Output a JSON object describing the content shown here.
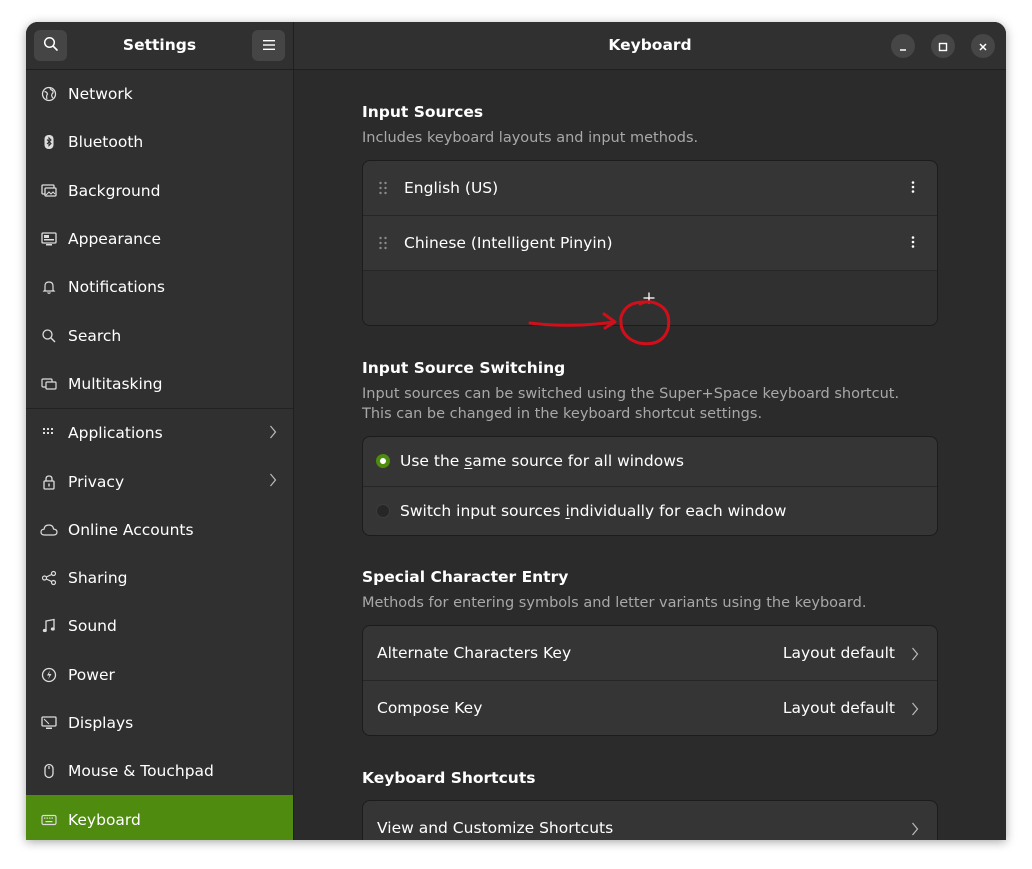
{
  "sidebar": {
    "title": "Settings",
    "search_icon": "search-icon",
    "menu_icon": "hamburger-menu-icon",
    "items": [
      {
        "label": "Network",
        "icon": "globe-icon"
      },
      {
        "label": "Bluetooth",
        "icon": "bluetooth-icon"
      },
      {
        "label": "Background",
        "icon": "background-icon"
      },
      {
        "label": "Appearance",
        "icon": "appearance-icon"
      },
      {
        "label": "Notifications",
        "icon": "bell-icon"
      },
      {
        "label": "Search",
        "icon": "search-icon"
      },
      {
        "label": "Multitasking",
        "icon": "multitasking-icon"
      },
      {
        "label": "Applications",
        "icon": "grid-icon"
      },
      {
        "label": "Privacy",
        "icon": "lock-icon"
      },
      {
        "label": "Online Accounts",
        "icon": "cloud-icon"
      },
      {
        "label": "Sharing",
        "icon": "share-icon"
      },
      {
        "label": "Sound",
        "icon": "music-note-icon"
      },
      {
        "label": "Power",
        "icon": "power-icon"
      },
      {
        "label": "Displays",
        "icon": "display-icon"
      },
      {
        "label": "Mouse & Touchpad",
        "icon": "mouse-icon"
      },
      {
        "label": "Keyboard",
        "icon": "keyboard-icon"
      }
    ],
    "active": "Keyboard"
  },
  "header": {
    "title": "Keyboard"
  },
  "input_sources": {
    "title": "Input Sources",
    "description": "Includes keyboard layouts and input methods.",
    "sources": [
      {
        "label": "English (US)"
      },
      {
        "label": "Chinese (Intelligent Pinyin)"
      }
    ],
    "annotation": "red hand-drawn arrow and circle around add button"
  },
  "switching": {
    "title": "Input Source Switching",
    "description_1": "Input sources can be switched using the Super+Space keyboard shortcut.",
    "description_2": "This can be changed in the keyboard shortcut settings.",
    "option_same_pre": "Use the ",
    "option_same_u": "s",
    "option_same_post": "ame source for all windows",
    "option_indiv_pre": "Switch input sources ",
    "option_indiv_u": "i",
    "option_indiv_post": "ndividually for each window",
    "selected": "same"
  },
  "special": {
    "title": "Special Character Entry",
    "description": "Methods for entering symbols and letter variants using the keyboard.",
    "rows": [
      {
        "label": "Alternate Characters Key",
        "value": "Layout default"
      },
      {
        "label": "Compose Key",
        "value": "Layout default"
      }
    ]
  },
  "shortcuts": {
    "title": "Keyboard Shortcuts",
    "row_label": "View and Customize Shortcuts"
  },
  "colors": {
    "accent": "#4e8b0f",
    "annotation": "#d10f1a"
  }
}
